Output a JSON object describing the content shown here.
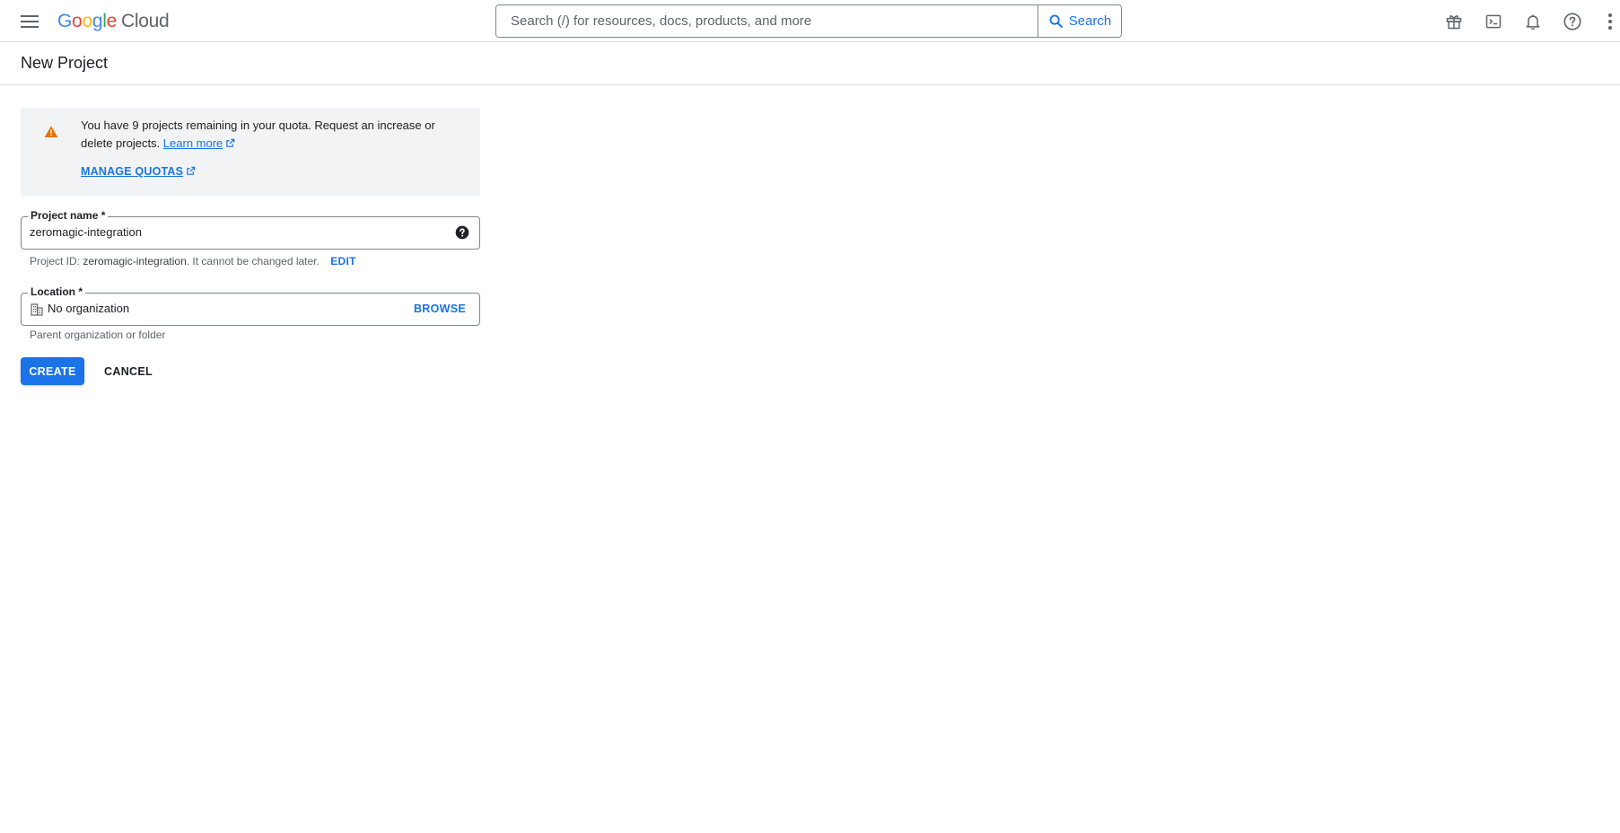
{
  "topbar": {
    "logo": {
      "letters": [
        "G",
        "o",
        "o",
        "g",
        "l",
        "e"
      ],
      "product": "Cloud"
    },
    "search": {
      "placeholder": "Search (/) for resources, docs, products, and more",
      "button_label": "Search"
    },
    "icons": [
      "gift-icon",
      "cloud-shell-icon",
      "notifications-icon",
      "help-icon",
      "more-vert-icon"
    ]
  },
  "page": {
    "title": "New Project"
  },
  "notice": {
    "message": "You have 9 projects remaining in your quota. Request an increase or delete projects.",
    "learn_more": "Learn more",
    "manage_quotas": "MANAGE QUOTAS"
  },
  "project_name": {
    "label": "Project name *",
    "value": "zeromagic-integration",
    "hint_prefix": "Project ID:",
    "hint_id": "zeromagic-integration",
    "hint_suffix": ". It cannot be changed later.",
    "edit": "EDIT"
  },
  "location": {
    "label": "Location *",
    "value": "No organization",
    "browse": "BROWSE",
    "hint": "Parent organization or folder"
  },
  "actions": {
    "create": "CREATE",
    "cancel": "CANCEL"
  },
  "colors": {
    "accent": "#1a73e8",
    "warning": "#e37400",
    "google_blue": "#4285f4",
    "google_red": "#ea4335",
    "google_yellow": "#fbbc04",
    "google_green": "#34a853"
  }
}
